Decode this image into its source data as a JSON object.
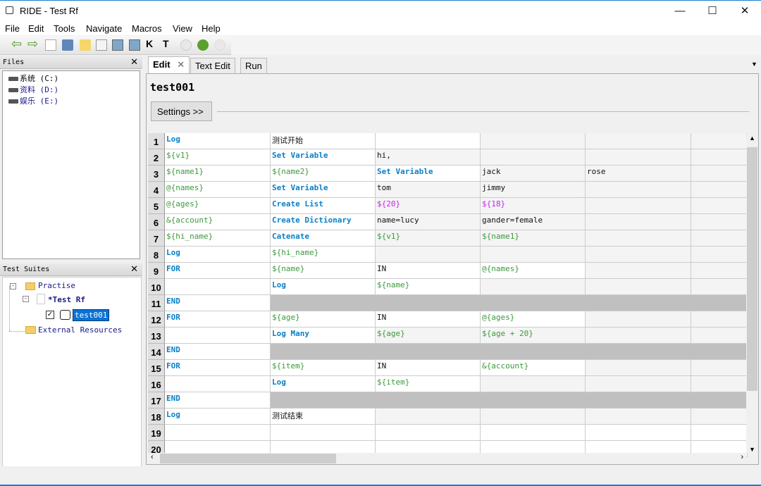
{
  "window": {
    "title": "RIDE - Test Rf",
    "minimize": "—",
    "maximize": "☐",
    "close": "✕"
  },
  "menu": [
    "File",
    "Edit",
    "Tools",
    "Navigate",
    "Macros",
    "View",
    "Help"
  ],
  "toolbar": {
    "icons": [
      "back-icon",
      "forward-icon",
      "new-project-icon",
      "open-icon",
      "open-directory-icon",
      "new-resource-icon",
      "save-icon",
      "save-all-icon",
      "search-keywords-icon",
      "search-tests-icon",
      "run-icon",
      "debug-icon",
      "stop-icon"
    ],
    "k_label": "K",
    "t_label": "T"
  },
  "files": {
    "title": "Files",
    "close": "✕",
    "items": [
      "系统 (C:)",
      "资料 (D:)",
      "娱乐 (E:)"
    ]
  },
  "suites": {
    "title": "Test Suites",
    "close": "✕",
    "project": "Practise",
    "suite": "*Test Rf",
    "test": "test001",
    "external": "External Resources"
  },
  "tabs": [
    {
      "label": "Edit",
      "close": "✕"
    },
    {
      "label": "Text Edit"
    },
    {
      "label": "Run"
    }
  ],
  "editor": {
    "name": "test001",
    "settings_button": "Settings >>"
  },
  "grid": {
    "rows": [
      {
        "n": "1",
        "white": 3,
        "cells": [
          [
            "Log",
            "kw"
          ],
          [
            "测试开始",
            "txt"
          ]
        ]
      },
      {
        "n": "2",
        "white": 2,
        "cells": [
          [
            "${v1}",
            "var"
          ],
          [
            "Set Variable",
            "kw"
          ],
          [
            "hi,",
            "txt"
          ]
        ]
      },
      {
        "n": "3",
        "white": 3,
        "cells": [
          [
            "${name1}",
            "var"
          ],
          [
            "${name2}",
            "var"
          ],
          [
            "Set Variable",
            "kw"
          ],
          [
            "jack",
            "txt"
          ],
          [
            "rose",
            "txt"
          ]
        ]
      },
      {
        "n": "4",
        "white": 2,
        "cells": [
          [
            "@{names}",
            "var"
          ],
          [
            "Set Variable",
            "kw"
          ],
          [
            "tom",
            "txt"
          ],
          [
            "jimmy",
            "txt"
          ]
        ]
      },
      {
        "n": "5",
        "white": 2,
        "cells": [
          [
            "@{ages}",
            "var"
          ],
          [
            "Create List",
            "kw"
          ],
          [
            "${20}",
            "num"
          ],
          [
            "${18}",
            "num"
          ]
        ]
      },
      {
        "n": "6",
        "white": 2,
        "cells": [
          [
            "&{account}",
            "var"
          ],
          [
            "Create Dictionary",
            "kw"
          ],
          [
            "name=lucy",
            "txt"
          ],
          [
            "gander=female",
            "txt"
          ]
        ]
      },
      {
        "n": "7",
        "white": 2,
        "cells": [
          [
            "${hi_name}",
            "var"
          ],
          [
            "Catenate",
            "kw"
          ],
          [
            "${v1}",
            "var"
          ],
          [
            "${name1}",
            "var"
          ]
        ]
      },
      {
        "n": "8",
        "white": 2,
        "cells": [
          [
            "Log",
            "kw"
          ],
          [
            "${hi_name}",
            "var"
          ]
        ]
      },
      {
        "n": "9",
        "white": 4,
        "cells": [
          [
            "FOR",
            "kw"
          ],
          [
            "${name}",
            "var"
          ],
          [
            "IN",
            "txt"
          ],
          [
            "@{names}",
            "var"
          ]
        ]
      },
      {
        "n": "10",
        "white": 3,
        "cells": [
          [
            "",
            ""
          ],
          [
            "Log",
            "kw"
          ],
          [
            "${name}",
            "var"
          ]
        ]
      },
      {
        "n": "11",
        "white": 1,
        "end": true,
        "cells": [
          [
            "END",
            "kw"
          ]
        ]
      },
      {
        "n": "12",
        "white": 4,
        "cells": [
          [
            "FOR",
            "kw"
          ],
          [
            "${age}",
            "var"
          ],
          [
            "IN",
            "txt"
          ],
          [
            "@{ages}",
            "var"
          ]
        ]
      },
      {
        "n": "13",
        "white": 2,
        "cells": [
          [
            "",
            ""
          ],
          [
            "Log Many",
            "kw"
          ],
          [
            "${age}",
            "var"
          ],
          [
            "${age + 20}",
            "var"
          ]
        ]
      },
      {
        "n": "14",
        "white": 1,
        "end": true,
        "cells": [
          [
            "END",
            "kw"
          ]
        ]
      },
      {
        "n": "15",
        "white": 4,
        "cells": [
          [
            "FOR",
            "kw"
          ],
          [
            "${item}",
            "var"
          ],
          [
            "IN",
            "txt"
          ],
          [
            "&{account}",
            "var"
          ]
        ]
      },
      {
        "n": "16",
        "white": 3,
        "cells": [
          [
            "",
            ""
          ],
          [
            "Log",
            "kw"
          ],
          [
            "${item}",
            "var"
          ]
        ]
      },
      {
        "n": "17",
        "white": 1,
        "end": true,
        "cells": [
          [
            "END",
            "kw"
          ]
        ]
      },
      {
        "n": "18",
        "white": 2,
        "cells": [
          [
            "Log",
            "kw"
          ],
          [
            "测试结束",
            "txt"
          ]
        ]
      },
      {
        "n": "19",
        "white": 6,
        "cells": []
      },
      {
        "n": "20",
        "white": 6,
        "cells": []
      }
    ]
  }
}
